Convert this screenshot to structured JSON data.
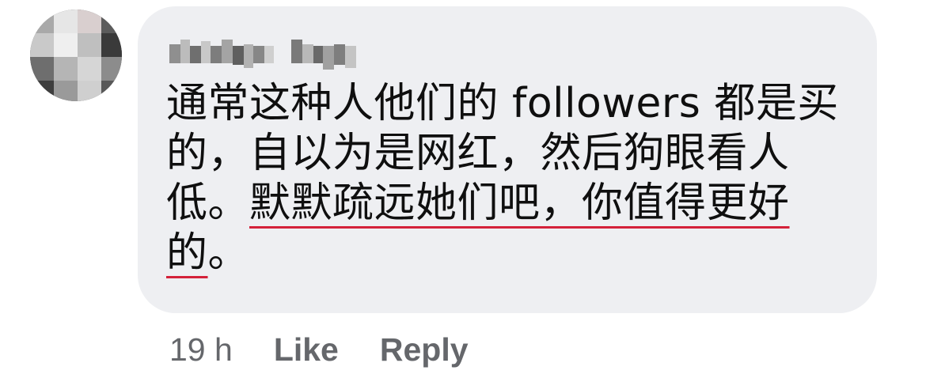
{
  "comment": {
    "author_name": "",
    "author_blurred": true,
    "avatar_blurred": true,
    "text_plain": "通常这种人他们的 followers 都是买的，自以为是网红，然后狗眼看人低。",
    "text_highlighted": "默默疏远她们吧，你值得更好的",
    "text_tail": "。",
    "timestamp": "19 h",
    "like_label": "Like",
    "reply_label": "Reply"
  },
  "colors": {
    "bubble_bg": "#eeeff2",
    "text": "#0f0f0f",
    "meta_text": "#65676b",
    "highlight_underline": "#d4213a"
  }
}
